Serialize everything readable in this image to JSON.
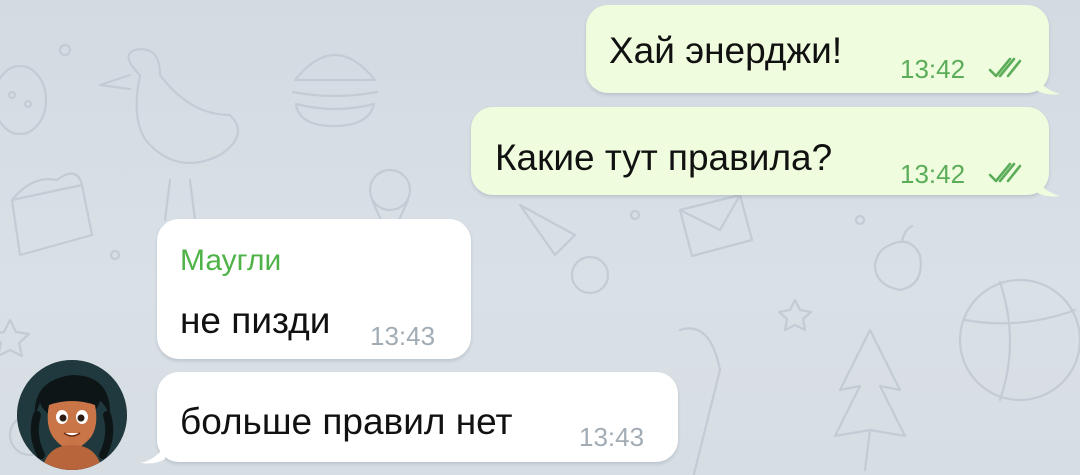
{
  "chat": {
    "messages": [
      {
        "direction": "outgoing",
        "text": "Хай энерджи!",
        "time": "13:42",
        "status_icon": "double-check-icon"
      },
      {
        "direction": "outgoing",
        "text": "Какие тут правила?",
        "time": "13:42",
        "status_icon": "double-check-icon"
      },
      {
        "direction": "incoming",
        "sender": "Маугли",
        "text": "не пизди",
        "time": "13:43"
      },
      {
        "direction": "incoming",
        "text": "больше правил нет",
        "time": "13:43"
      }
    ],
    "avatar_icon": "user-avatar-icon"
  },
  "colors": {
    "background": "#d5dde4",
    "outgoing_bubble": "#effdde",
    "incoming_bubble": "#ffffff",
    "outgoing_time": "#5cad5a",
    "incoming_time": "#a2acb4",
    "sender_name": "#4eb247",
    "text": "#111111"
  }
}
